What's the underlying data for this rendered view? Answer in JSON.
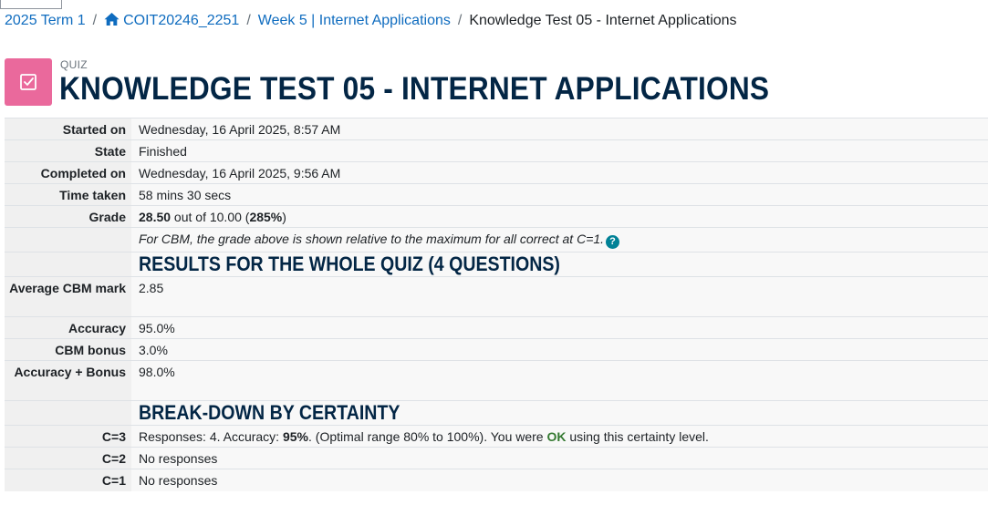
{
  "breadcrumb": {
    "term": "2025 Term 1",
    "course": "COIT20246_2251",
    "week": "Week 5 | Internet Applications",
    "current": "Knowledge Test 05 - Internet Applications",
    "separator": "/"
  },
  "header": {
    "module_label": "QUIZ",
    "title": "KNOWLEDGE TEST 05 - INTERNET APPLICATIONS",
    "icon": "quiz-checkbox-icon",
    "icon_color": "#ea699c"
  },
  "summary": {
    "started_on_label": "Started on",
    "started_on": "Wednesday, 16 April 2025, 8:57 AM",
    "state_label": "State",
    "state": "Finished",
    "completed_on_label": "Completed on",
    "completed_on": "Wednesday, 16 April 2025, 9:56 AM",
    "time_taken_label": "Time taken",
    "time_taken": "58 mins 30 secs",
    "grade_label": "Grade",
    "grade_value": "28.50",
    "grade_out_of": " out of 10.00 (",
    "grade_percent": "285%",
    "grade_close": ")",
    "cbm_note": "For CBM, the grade above is shown relative to the maximum for all correct at C=1.",
    "help_icon": "?"
  },
  "results": {
    "heading": "RESULTS FOR THE WHOLE QUIZ (4 QUESTIONS)",
    "avg_cbm_label": "Average CBM mark",
    "avg_cbm": "2.85",
    "accuracy_label": "Accuracy",
    "accuracy": "95.0%",
    "cbm_bonus_label": "CBM bonus",
    "cbm_bonus": "3.0%",
    "accuracy_bonus_label": "Accuracy + Bonus",
    "accuracy_bonus": "98.0%"
  },
  "breakdown": {
    "heading": "BREAK-DOWN BY CERTAINTY",
    "c3_label": "C=3",
    "c3_pre": "Responses: 4. Accuracy: ",
    "c3_accuracy": "95%",
    "c3_mid": ". (Optimal range 80% to 100%). You were ",
    "c3_ok": "OK",
    "c3_post": " using this certainty level.",
    "c2_label": "C=2",
    "c2": "No responses",
    "c1_label": "C=1",
    "c1": "No responses"
  },
  "colors": {
    "link": "#0f6cbf",
    "heading": "#032645",
    "ok": "#357a32",
    "help": "#008196"
  }
}
